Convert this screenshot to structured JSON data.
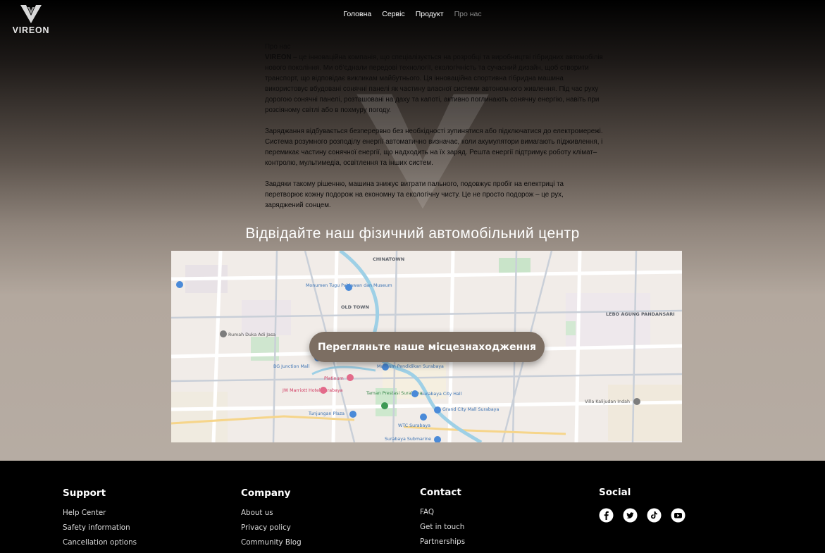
{
  "brand": {
    "name": "VIREON"
  },
  "nav": [
    {
      "label": "Головна"
    },
    {
      "label": "Сервіс"
    },
    {
      "label": "Продукт"
    },
    {
      "label": "Про нас"
    }
  ],
  "about": {
    "heading": "Про нас",
    "brand_word": "VIREON",
    "p1_rest": " – це інноваційна компанія, що спеціалізується на розробці та виробництві гібридних автомобілів нового покоління. Ми об’єднали передові технології, екологічність та сучасний дизайн, щоб створити транспорт, що відповідає викликам майбутнього. Ця інноваційна спортивна гібридна машина використовує вбудовані сонячні панелі як частину власної системи автономного живлення. Під час руху дорогою сонячні панелі, розташовані на даху та капоті, активно поглинають сонячну енергію, навіть при розсіяному світлі або в похмуру погоду.",
    "p2": "Заряджання відбувається безперервно без необхідності зупинятися або підключатися до електромережі. Система розумного розподілу енергії автоматично визначає, коли акумулятори вимагають підживлення, і перемикає частину сонячної енергії, що надходить на їх заряд. Решта енергії підтримує роботу клімат–контролю, мультимедіа, освітлення та інших систем.",
    "p3": "Завдяки такому рішенню, машина знижує витрати пального, подовжує пробіг на електриці та перетворює кожну подорож на економну та екологічну чисту. Це не просто подорож – це рух, заряджений сонцем."
  },
  "map_section": {
    "title": "Відвідайте наш фізичний автомобільний центр",
    "button": "Перегляньте наше місцезнаходження",
    "labels": {
      "chinatown": "CHINATOWN",
      "old_town": "OLD TOWN",
      "lebo": "LEBO AGUNG PANDANSARI",
      "monumen": "Monumen Tugu Pahlawan dan Museum",
      "rumah": "Rumah Duka Adi Jasa",
      "bg": "BG Junction Mall",
      "platinum": "Platinum",
      "jw": "JW Marriott Hotel Surabaya",
      "museum": "Museum Pendidikan Surabaya",
      "taman": "Taman Prestasi Surabaya",
      "city_hall": "Surabaya City Hall",
      "grand_city": "Grand City Mall Surabaya",
      "tunjungan": "Tunjungan Plaza",
      "wtc": "WTC Surabaya",
      "submarine": "Surabaya Submarine",
      "villa": "Villa Kalijudan Indah"
    }
  },
  "footer": {
    "support": {
      "title": "Support",
      "links": [
        "Help Center",
        "Safety information",
        "Cancellation options"
      ]
    },
    "company": {
      "title": "Company",
      "links": [
        "About us",
        "Privacy policy",
        "Community Blog"
      ]
    },
    "contact": {
      "title": "Contact",
      "links": [
        "FAQ",
        "Get in touch",
        "Partnerships"
      ]
    },
    "social": {
      "title": "Social",
      "icons": [
        "facebook-icon",
        "twitter-icon",
        "tiktok-icon",
        "youtube-icon"
      ]
    }
  },
  "colors": {
    "button": "#7c6e62",
    "footer_bg": "#000000",
    "nav_active": "#8a8a8a"
  }
}
